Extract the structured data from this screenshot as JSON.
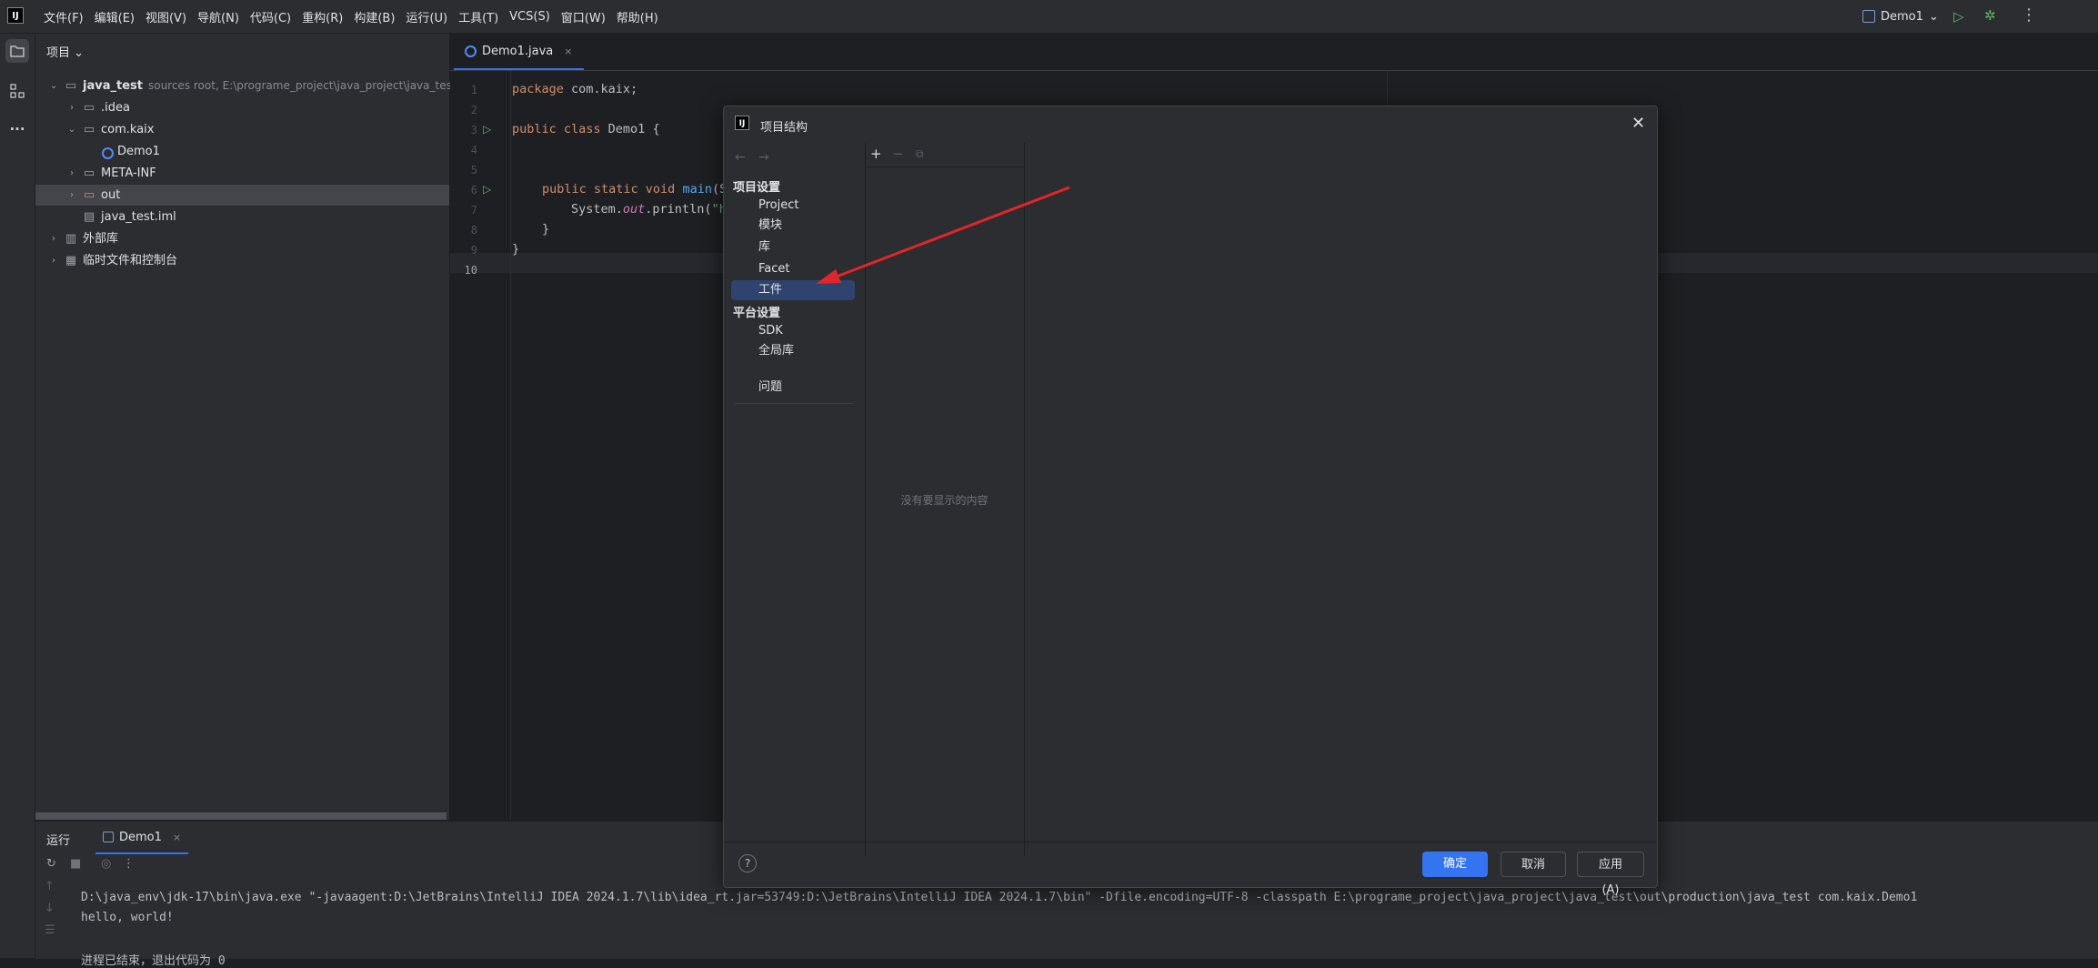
{
  "menubar": {
    "logo": "IJ",
    "items": [
      "文件(F)",
      "编辑(E)",
      "视图(V)",
      "导航(N)",
      "代码(C)",
      "重构(R)",
      "构建(B)",
      "运行(U)",
      "工具(T)",
      "VCS(S)",
      "窗口(W)",
      "帮助(H)"
    ],
    "run_config": "Demo1",
    "run_config_chevron": "⌄",
    "run_icon": "▷",
    "debug_icon": "✲",
    "more_icon": "⋮"
  },
  "toolstrip": {
    "project_icon": "folder-icon",
    "structure_icon": "structure-icon",
    "more_icon": "more-icon"
  },
  "project": {
    "header": "项目",
    "header_chevron": "⌄",
    "tree": [
      {
        "label": "java_test",
        "hint": "sources root,  E:\\programe_project\\java_project\\java_test"
      },
      {
        "label": ".idea"
      },
      {
        "label": "com.kaix"
      },
      {
        "label": "Demo1"
      },
      {
        "label": "META-INF"
      },
      {
        "label": "out"
      },
      {
        "label": "java_test.iml"
      },
      {
        "label": "外部库"
      },
      {
        "label": "临时文件和控制台"
      }
    ]
  },
  "editor": {
    "tab_label": "Demo1.java",
    "tab_close": "×",
    "line_numbers": [
      "1",
      "2",
      "3",
      "4",
      "5",
      "6",
      "7",
      "8",
      "9",
      "10"
    ],
    "code": {
      "l1_kw": "package",
      "l1_rest": " com.kaix;",
      "l3_kw": "public class",
      "l3_rest": " Demo1 {",
      "l6_kw": "public static void",
      "l6_fn": " main",
      "l6_rest": "(S",
      "l7_a": "System.",
      "l7_fld": "out",
      "l7_b": ".println(",
      "l7_str": "\"h",
      "l8": "}",
      "l9": "}"
    }
  },
  "run_panel": {
    "title": "运行",
    "tab": "Demo1",
    "tab_close": "×",
    "console": [
      "D:\\java_env\\jdk-17\\bin\\java.exe \"-javaagent:D:\\JetBrains\\IntelliJ IDEA 2024.1.7\\lib\\idea_rt.jar=53749:D:\\JetBrains\\IntelliJ IDEA 2024.1.7\\bin\" -Dfile.encoding=UTF-8 -classpath E:\\programe_project\\java_project\\java_test\\out\\production\\java_test com.kaix.Demo1",
      "hello, world!",
      "",
      "进程已结束，退出代码为 0"
    ]
  },
  "dialog": {
    "logo": "IJ",
    "title": "项目结构",
    "close": "✕",
    "nav_back": "←",
    "nav_forward": "→",
    "section_project": "项目设置",
    "project_items": [
      "Project",
      "模块",
      "库",
      "Facet",
      "工件"
    ],
    "section_platform": "平台设置",
    "platform_items": [
      "SDK",
      "全局库"
    ],
    "problems": "问题",
    "selected_item": "工件",
    "mid_add": "+",
    "mid_remove": "−",
    "mid_copy": "⧉",
    "empty_text": "没有要显示的内容",
    "help": "?",
    "ok": "确定",
    "cancel": "取消",
    "apply": "应用(A)"
  },
  "colors": {
    "accent": "#3574f0",
    "selection": "#2e436e",
    "annotation_arrow": "#e0262b"
  }
}
